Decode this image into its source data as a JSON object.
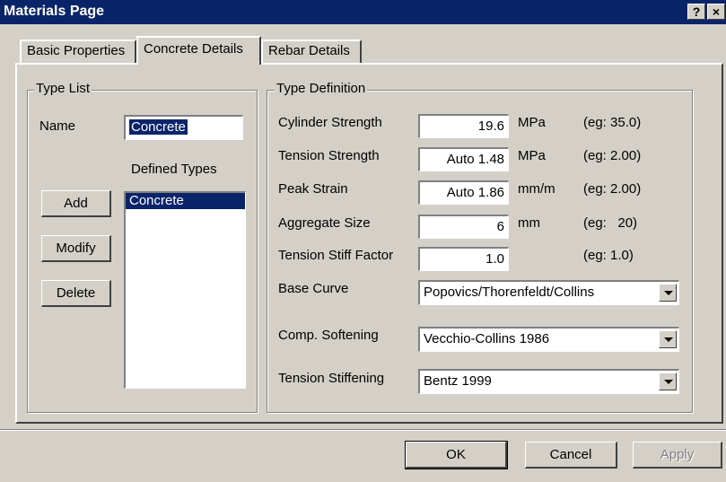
{
  "window": {
    "title": "Materials Page",
    "help_label": "?",
    "close_label": "×"
  },
  "tabs": [
    {
      "label": "Basic Properties"
    },
    {
      "label": "Concrete Details"
    },
    {
      "label": "Rebar Details"
    }
  ],
  "type_list": {
    "group_label": "Type List",
    "name_label": "Name",
    "name_value": "Concrete",
    "defined_types_label": "Defined Types",
    "items": [
      "Concrete"
    ],
    "add_label": "Add",
    "modify_label": "Modify",
    "delete_label": "Delete"
  },
  "type_definition": {
    "group_label": "Type Definition",
    "rows": [
      {
        "label": "Cylinder Strength",
        "value": "19.6",
        "unit": "MPa",
        "example": "(eg: 35.0)"
      },
      {
        "label": "Tension Strength",
        "value": "Auto 1.48",
        "unit": "MPa",
        "example": "(eg: 2.00)"
      },
      {
        "label": "Peak Strain",
        "value": "Auto 1.86",
        "unit": "mm/m",
        "example": "(eg: 2.00)"
      },
      {
        "label": "Aggregate Size",
        "value": "6",
        "unit": "mm",
        "example": "(eg:   20)"
      },
      {
        "label": "Tension Stiff Factor",
        "value": "1.0",
        "unit": "",
        "example": "(eg: 1.0)"
      }
    ],
    "dropdowns": [
      {
        "label": "Base Curve",
        "value": "Popovics/Thorenfeldt/Collins"
      },
      {
        "label": "Comp. Softening",
        "value": "Vecchio-Collins 1986"
      },
      {
        "label": "Tension Stiffening",
        "value": "Bentz 1999"
      }
    ]
  },
  "footer": {
    "ok_label": "OK",
    "cancel_label": "Cancel",
    "apply_label": "Apply"
  }
}
